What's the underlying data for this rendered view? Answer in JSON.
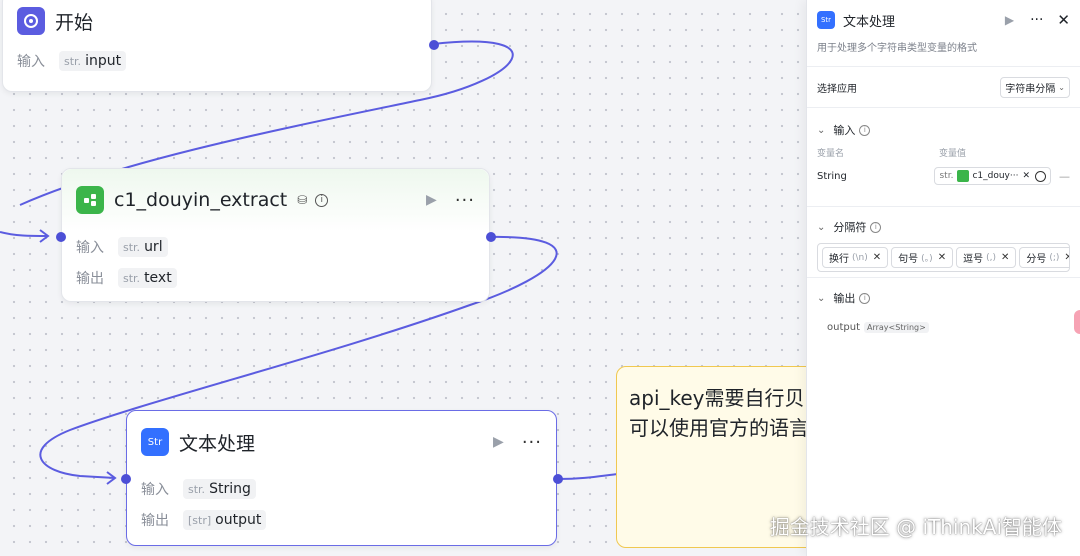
{
  "nodes": {
    "start": {
      "title": "开始",
      "input_label": "输入",
      "input_type": "str.",
      "input_name": "input"
    },
    "extract": {
      "title": "c1_douyin_extract",
      "input_label": "输入",
      "input_type": "str.",
      "input_name": "url",
      "output_label": "输出",
      "output_type": "str.",
      "output_name": "text"
    },
    "text": {
      "title": "文本处理",
      "icon_text": "Str",
      "input_label": "输入",
      "input_type": "str.",
      "input_name": "String",
      "output_label": "输出",
      "output_type": "[str]",
      "output_name": "output"
    }
  },
  "note": {
    "line1": "api_key需要自行贝",
    "line2": "可以使用官方的语言"
  },
  "panel": {
    "title": "文本处理",
    "description": "用于处理多个字符串类型变量的格式",
    "select_app_label": "选择应用",
    "select_app_value": "字符串分隔",
    "input_section": "输入",
    "col_var_name": "变量名",
    "col_var_value": "变量值",
    "var_name": "String",
    "var_type": "str.",
    "var_ref": "c1_douy···",
    "separator_section": "分隔符",
    "separators": [
      {
        "label": "换行",
        "sub": "(\\n)"
      },
      {
        "label": "句号",
        "sub": "(。)"
      },
      {
        "label": "逗号",
        "sub": "(,)"
      },
      {
        "label": "分号",
        "sub": "(;)"
      }
    ],
    "output_section": "输出",
    "output_name": "output",
    "output_type": "Array<String>"
  },
  "watermark": "掘金技术社区 @ iThinkAi智能体",
  "colors": {
    "accent": "#4c4fd6",
    "edge": "#5b5ce0",
    "plugin_green": "#3bb54a",
    "text_icon_blue": "#3370ff",
    "start_purple": "#5b5ce0",
    "note_yellow": "#fffbe8"
  }
}
